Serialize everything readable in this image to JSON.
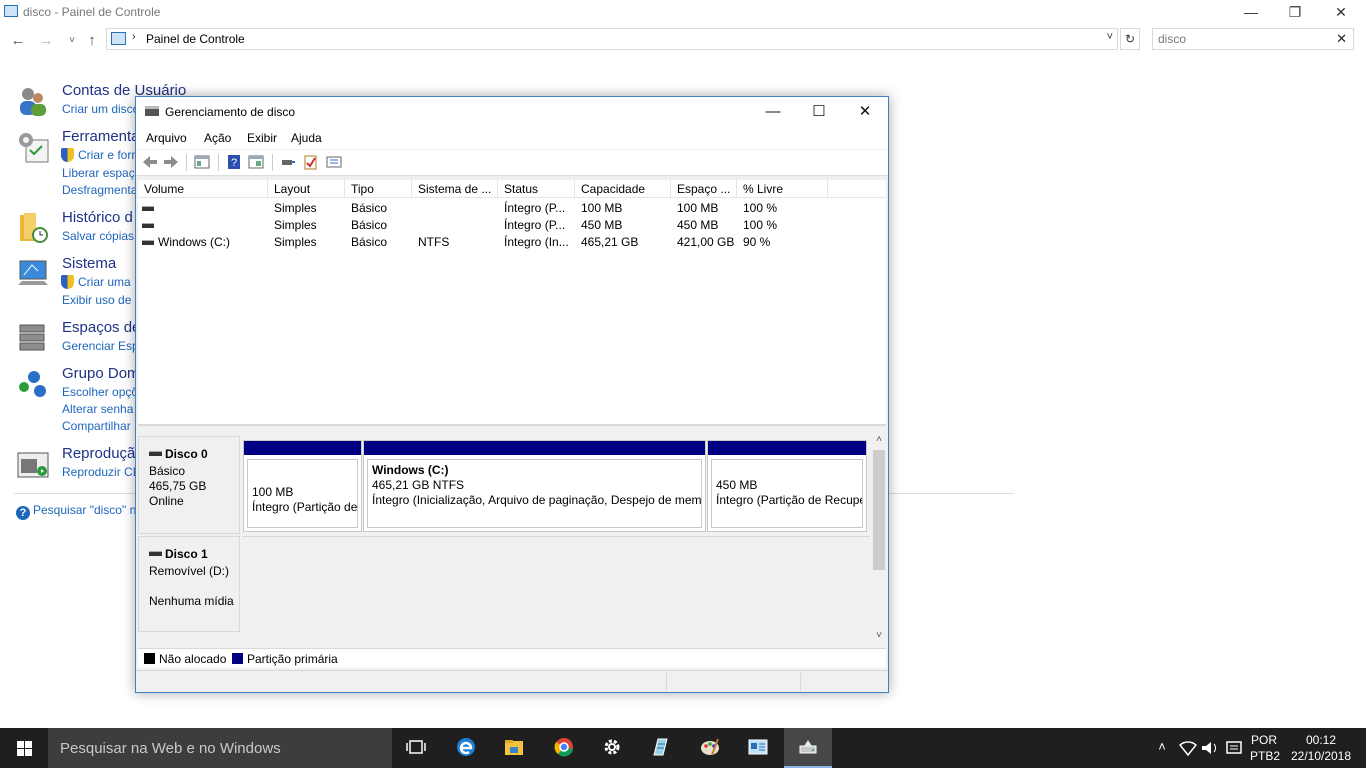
{
  "control_panel": {
    "title": "disco - Painel de Controle",
    "address": "Painel de Controle",
    "search_value": "disco",
    "categories": [
      {
        "title": "Contas de Usuário",
        "links": [
          "Criar um disco"
        ]
      },
      {
        "title": "Ferramentas",
        "links": [
          "Criar e form",
          "Liberar espaç",
          "Desfragmenta"
        ]
      },
      {
        "title": "Histórico d",
        "links": [
          "Salvar cópias"
        ]
      },
      {
        "title": "Sistema",
        "links": [
          "Criar uma",
          "Exibir uso de m"
        ]
      },
      {
        "title": "Espaços de",
        "links": [
          "Gerenciar Espa"
        ]
      },
      {
        "title": "Grupo Dom",
        "links": [
          "Escolher opçõ",
          "Alterar senha",
          "Compartilhar"
        ]
      },
      {
        "title": "Reproduçã",
        "links": [
          "Reproduzir CD"
        ]
      }
    ],
    "help_link": "Pesquisar \"disco\" n"
  },
  "disk_mgmt": {
    "title": "Gerenciamento de disco",
    "menu": [
      "Arquivo",
      "Ação",
      "Exibir",
      "Ajuda"
    ],
    "columns": [
      "Volume",
      "Layout",
      "Tipo",
      "Sistema de ...",
      "Status",
      "Capacidade",
      "Espaço ...",
      "% Livre"
    ],
    "volumes": [
      {
        "volume": "",
        "layout": "Simples",
        "tipo": "Básico",
        "sistema": "",
        "status": "Íntegro (P...",
        "capacidade": "100 MB",
        "espaco": "100 MB",
        "livre": "100 %"
      },
      {
        "volume": "",
        "layout": "Simples",
        "tipo": "Básico",
        "sistema": "",
        "status": "Íntegro (P...",
        "capacidade": "450 MB",
        "espaco": "450 MB",
        "livre": "100 %"
      },
      {
        "volume": "Windows (C:)",
        "layout": "Simples",
        "tipo": "Básico",
        "sistema": "NTFS",
        "status": "Íntegro (In...",
        "capacidade": "465,21 GB",
        "espaco": "421,00 GB",
        "livre": "90 %"
      }
    ],
    "disk0": {
      "name": "Disco 0",
      "type": "Básico",
      "size": "465,75 GB",
      "state": "Online",
      "partitions": [
        {
          "name": "",
          "size": "100 MB",
          "status": "Íntegro (Partição de"
        },
        {
          "name": "Windows  (C:)",
          "size": "465,21 GB NTFS",
          "status": "Íntegro (Inicialização, Arquivo de paginação, Despejo de mem"
        },
        {
          "name": "",
          "size": "450 MB",
          "status": "Íntegro (Partição de Recupe"
        }
      ]
    },
    "disk1": {
      "name": "Disco 1",
      "type": "Removível (D:)",
      "state": "Nenhuma mídia"
    },
    "legend": [
      {
        "label": "Não alocado",
        "color": "#000000"
      },
      {
        "label": "Partição primária",
        "color": "#000080"
      }
    ]
  },
  "taskbar": {
    "search_placeholder": "Pesquisar na Web e no Windows",
    "lang_top": "POR",
    "lang_bottom": "PTB2",
    "time": "00:12",
    "date": "22/10/2018"
  }
}
